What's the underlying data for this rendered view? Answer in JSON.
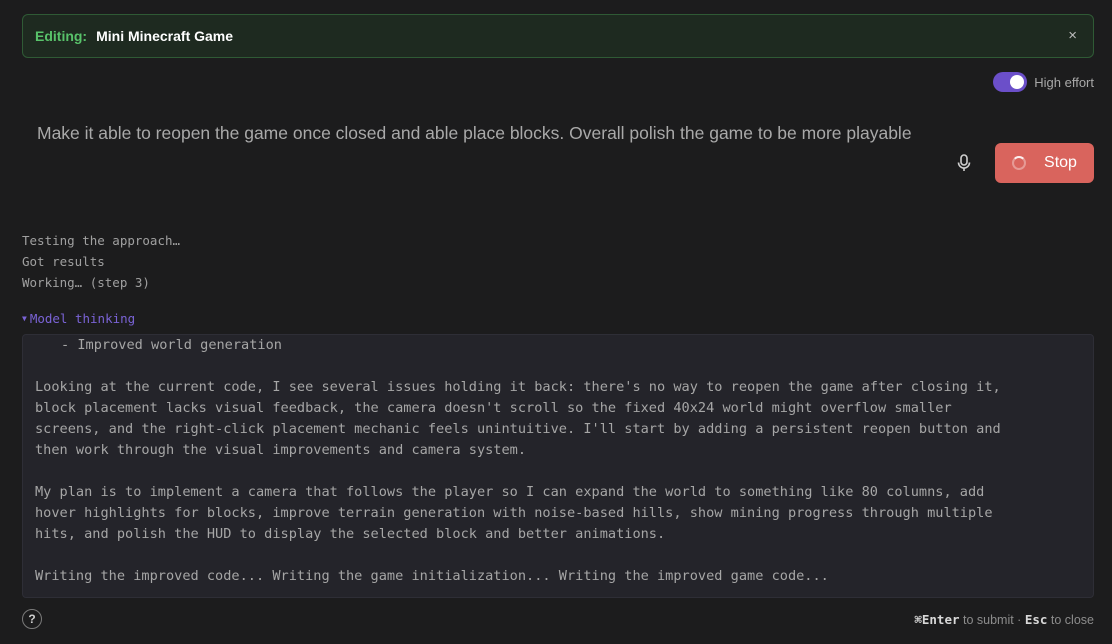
{
  "banner": {
    "label": "Editing:",
    "title": "Mini Minecraft Game",
    "close": "×"
  },
  "effort": {
    "label": "High effort",
    "enabled": true,
    "color": "#6b4fc9"
  },
  "prompt": {
    "text": "Make it able to reopen the game once closed and able place blocks. Overall polish the game to be more playable"
  },
  "controls": {
    "mic_icon": "microphone-icon",
    "stop_label": "Stop",
    "stop_color": "#d9645d"
  },
  "status": {
    "lines": [
      "Testing the approach…",
      "Got results",
      "Working… (step 3)"
    ]
  },
  "thinking": {
    "toggle_label": "Model thinking",
    "first_line": "- Improved world generation",
    "paragraphs": [
      "Looking at the current code, I see several issues holding it back: there's no way to reopen the game after closing it,\nblock placement lacks visual feedback, the camera doesn't scroll so the fixed 40x24 world might overflow smaller\nscreens, and the right-click placement mechanic feels unintuitive. I'll start by adding a persistent reopen button and\nthen work through the visual improvements and camera system.",
      "My plan is to implement a camera that follows the player so I can expand the world to something like 80 columns, add\nhover highlights for blocks, improve terrain generation with noise-based hills, show mining progress through multiple\nhits, and polish the HUD to display the selected block and better animations.",
      "Writing the improved code... Writing the game initialization... Writing the improved game code..."
    ]
  },
  "footer": {
    "help": "?",
    "submit_key": "⌘Enter",
    "submit_text": "to submit ·",
    "close_key": "Esc",
    "close_text": "to close"
  }
}
